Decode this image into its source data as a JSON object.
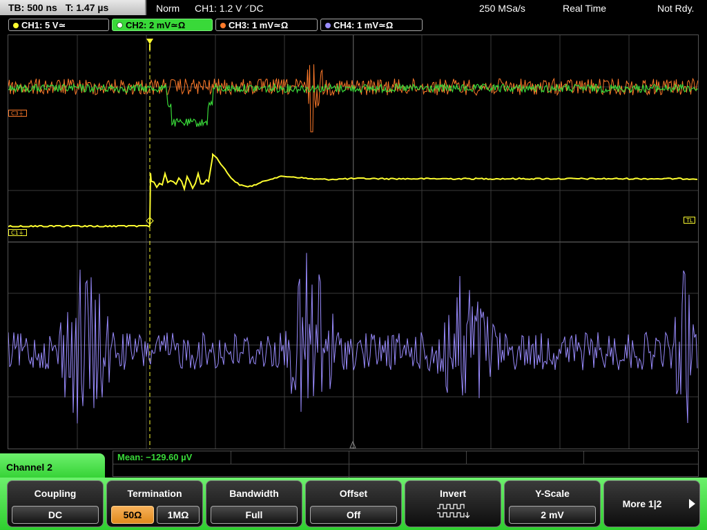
{
  "status": {
    "timebase": "TB: 500 ns",
    "trigger_time": "T: 1.47 µs",
    "trigger_mode": "Norm",
    "trigger_info": "CH1: 1.2 V ⸍DC",
    "sample_rate": "250 MSa/s",
    "acquisition_mode": "Real Time",
    "trigger_status": "Not Rdy."
  },
  "channels": [
    {
      "label": "CH1: 5 V≃",
      "color": "#ffff30"
    },
    {
      "label": "CH2: 2 mV≃Ω",
      "color": "#39d939"
    },
    {
      "label": "CH3: 1 mV≃Ω",
      "color": "#ff7a2a"
    },
    {
      "label": "CH4: 1 mV≃Ω",
      "color": "#9a8cff"
    }
  ],
  "markers": {
    "c3": "C3",
    "c1": "C1",
    "tl": "TL"
  },
  "measurement": {
    "mean": "Mean: −129.60 µV"
  },
  "menu": {
    "title": "Channel 2",
    "coupling": {
      "label": "Coupling",
      "value": "DC"
    },
    "termination": {
      "label": "Termination",
      "options": [
        "50Ω",
        "1MΩ"
      ],
      "selected": "50Ω"
    },
    "bandwidth": {
      "label": "Bandwidth",
      "value": "Full"
    },
    "offset": {
      "label": "Offset",
      "value": "Off"
    },
    "invert": {
      "label": "Invert",
      "icon": "invert-pulse-icon"
    },
    "yscale": {
      "label": "Y-Scale",
      "value": "2 mV"
    },
    "more": {
      "label": "More 1|2"
    }
  },
  "colors": {
    "ch1": "#ffff30",
    "ch2": "#39d939",
    "ch3": "#ff7a2a",
    "ch4": "#9a8cff",
    "menu_green": "#39d939",
    "selected_orange": "#f0a040"
  }
}
